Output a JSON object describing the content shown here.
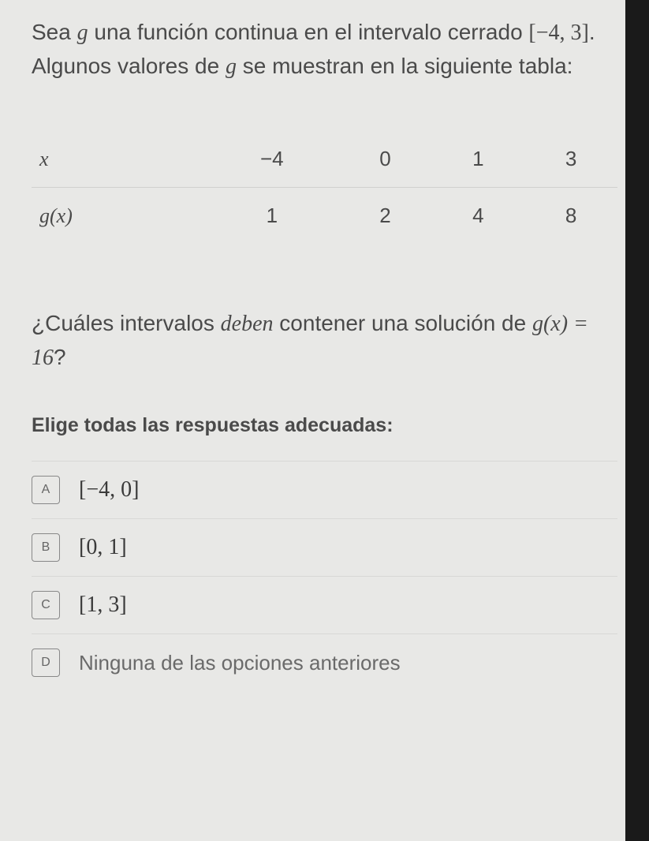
{
  "intro": {
    "part1": "Sea ",
    "g": "g",
    "part2": " una función continua en el intervalo cerrado ",
    "interval": "[−4, 3]",
    "part3": ". Algunos valores de ",
    "g2": "g",
    "part4": " se muestran en la siguiente tabla:"
  },
  "table": {
    "row1": {
      "header": "x",
      "c1": "−4",
      "c2": "0",
      "c3": "1",
      "c4": "3"
    },
    "row2": {
      "header": "g(x)",
      "c1": "1",
      "c2": "2",
      "c3": "4",
      "c4": "8"
    }
  },
  "question": {
    "part1": "¿Cuáles intervalos ",
    "deben": "deben",
    "part2": " contener una solución de ",
    "eq": "g(x) = 16",
    "qmark": "?"
  },
  "instruction": "Elige todas las respuestas adecuadas:",
  "options": {
    "a": {
      "key": "A",
      "text": "[−4, 0]"
    },
    "b": {
      "key": "B",
      "text": "[0, 1]"
    },
    "c": {
      "key": "C",
      "text": "[1, 3]"
    },
    "d": {
      "key": "D",
      "text": "Ninguna de las opciones anteriores"
    }
  }
}
